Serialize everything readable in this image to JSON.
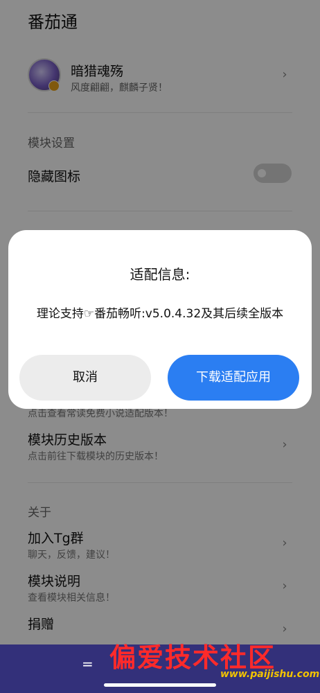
{
  "app": {
    "title": "番茄通"
  },
  "profile": {
    "name": "暗猎魂殇",
    "subtitle": "风度翩翩，麒麟子贤！"
  },
  "sections": {
    "module_settings": "模块设置",
    "hide_icon": "隐藏图标",
    "hide_icon_enabled": false,
    "partial_hint": "点击查看常读免费小说适配版本！",
    "history_title": "模块历史版本",
    "history_sub": "点击前往下载模块的历史版本！",
    "about": "关于",
    "join_title": "加入Tg群",
    "join_sub": "聊天，反馈，建议！",
    "desc_title": "模块说明",
    "desc_sub": "查看模块相关信息！",
    "donate_title": "捐赠"
  },
  "dialog": {
    "title": "适配信息:",
    "body": "理论支持☞番茄畅听:v5.0.4.32及其后续全版本",
    "cancel_label": "取消",
    "download_label": "下载适配应用"
  },
  "navbar": {
    "eq": "=",
    "watermark": "偏爱技术社区",
    "watermark_url": "www.paijishu.com"
  },
  "colors": {
    "accent": "#2b7ef2",
    "navbar": "#33307a",
    "watermark": "#ff2a2a"
  }
}
